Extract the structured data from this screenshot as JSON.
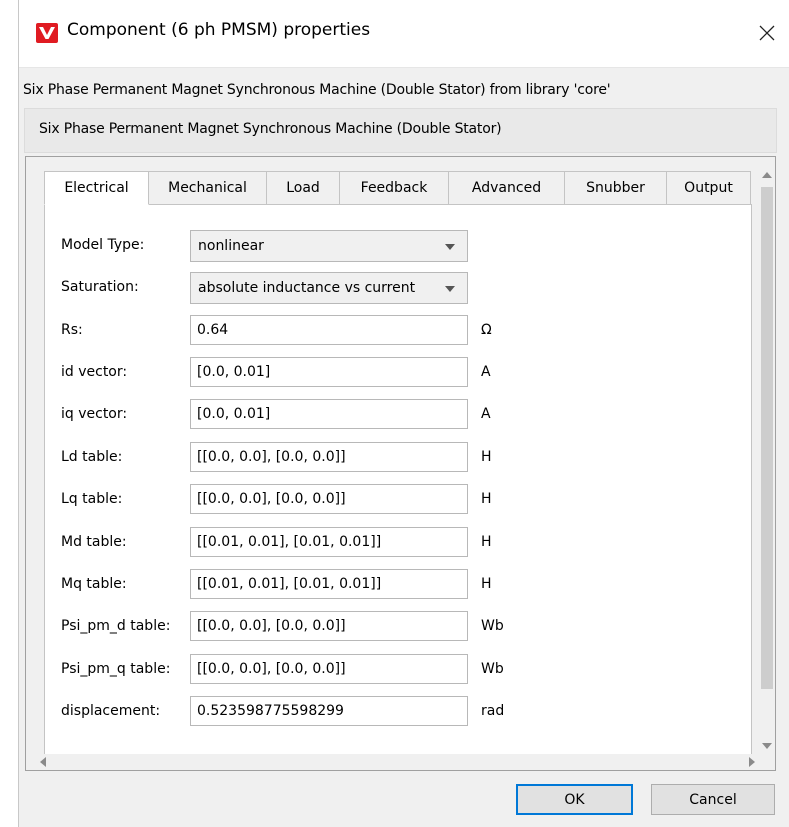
{
  "window": {
    "title": "Component (6 ph PMSM) properties",
    "close_glyph": "✕",
    "app_icon": "logo-icon",
    "accent": "#0078d7",
    "logo_color": "#e01b22"
  },
  "description": {
    "source_line": "Six Phase Permanent Magnet Synchronous Machine (Double Stator) from library 'core'",
    "box_text": "Six Phase Permanent Magnet Synchronous Machine (Double Stator)"
  },
  "tabs": [
    {
      "label": "Electrical",
      "active": true
    },
    {
      "label": "Mechanical",
      "active": false
    },
    {
      "label": "Load",
      "active": false
    },
    {
      "label": "Feedback",
      "active": false
    },
    {
      "label": "Advanced",
      "active": false
    },
    {
      "label": "Snubber",
      "active": false
    },
    {
      "label": "Output",
      "active": false
    }
  ],
  "params": {
    "model_type": {
      "label": "Model Type:",
      "value": "nonlinear"
    },
    "saturation": {
      "label": "Saturation:",
      "value": "absolute inductance vs current"
    },
    "rs": {
      "label": "Rs:",
      "value": "0.64",
      "unit": "Ω"
    },
    "id_vector": {
      "label": "id vector:",
      "value": "[0.0, 0.01]",
      "unit": "A"
    },
    "iq_vector": {
      "label": "iq vector:",
      "value": "[0.0, 0.01]",
      "unit": "A"
    },
    "ld_table": {
      "label": "Ld table:",
      "value": "[[0.0, 0.0], [0.0, 0.0]]",
      "unit": "H"
    },
    "lq_table": {
      "label": "Lq table:",
      "value": "[[0.0, 0.0], [0.0, 0.0]]",
      "unit": "H"
    },
    "md_table": {
      "label": "Md table:",
      "value": "[[0.01, 0.01], [0.01, 0.01]]",
      "unit": "H"
    },
    "mq_table": {
      "label": "Mq table:",
      "value": "[[0.01, 0.01], [0.01, 0.01]]",
      "unit": "H"
    },
    "psi_pm_d": {
      "label": "Psi_pm_d table:",
      "value": "[[0.0, 0.0], [0.0, 0.0]]",
      "unit": "Wb"
    },
    "psi_pm_q": {
      "label": "Psi_pm_q table:",
      "value": "[[0.0, 0.0], [0.0, 0.0]]",
      "unit": "Wb"
    },
    "displacement": {
      "label": "displacement:",
      "value": "0.523598775598299",
      "unit": "rad"
    }
  },
  "buttons": {
    "ok": "OK",
    "cancel": "Cancel"
  }
}
